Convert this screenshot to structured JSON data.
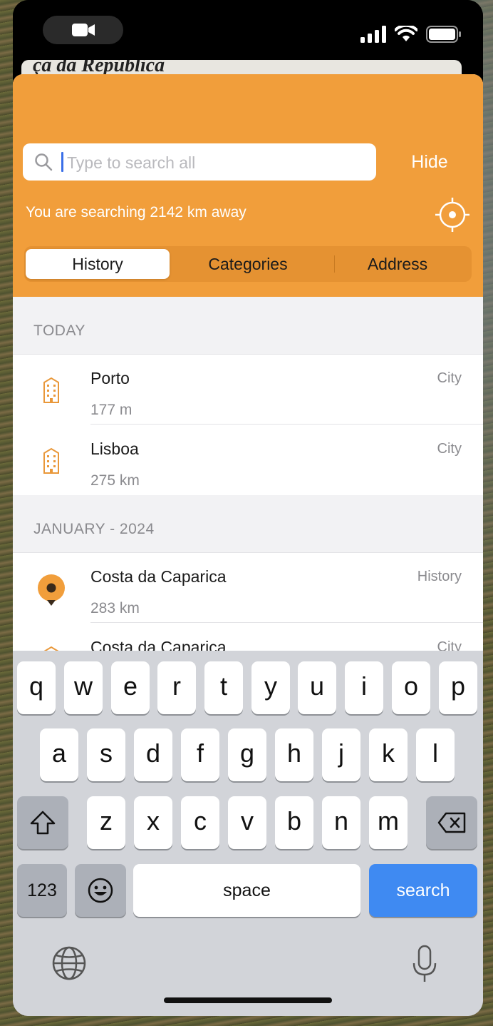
{
  "map": {
    "street_label": "ça da República"
  },
  "search": {
    "placeholder": "Type to search all",
    "value": "",
    "hide_label": "Hide"
  },
  "distance_notice": "You are searching 2142 km away",
  "tabs": [
    {
      "label": "History",
      "active": true
    },
    {
      "label": "Categories",
      "active": false
    },
    {
      "label": "Address",
      "active": false
    }
  ],
  "sections": [
    {
      "header": "TODAY",
      "items": [
        {
          "title": "Porto",
          "subtitle": "177 m",
          "type": "City",
          "icon": "building-icon"
        },
        {
          "title": "Lisboa",
          "subtitle": "275 km",
          "type": "City",
          "icon": "building-icon"
        }
      ]
    },
    {
      "header": "JANUARY - 2024",
      "items": [
        {
          "title": "Costa da Caparica",
          "subtitle": "283 km",
          "type": "History",
          "icon": "map-pin-icon"
        },
        {
          "title": "Costa da Caparica",
          "subtitle": "",
          "type": "City",
          "icon": "building-icon"
        }
      ]
    }
  ],
  "keyboard": {
    "row1": [
      "q",
      "w",
      "e",
      "r",
      "t",
      "y",
      "u",
      "i",
      "o",
      "p"
    ],
    "row2": [
      "a",
      "s",
      "d",
      "f",
      "g",
      "h",
      "j",
      "k",
      "l"
    ],
    "row3": [
      "z",
      "x",
      "c",
      "v",
      "b",
      "n",
      "m"
    ],
    "numbers_label": "123",
    "space_label": "space",
    "search_label": "search"
  },
  "colors": {
    "accent": "#f19e3b",
    "key_blue": "#3f8af2"
  }
}
